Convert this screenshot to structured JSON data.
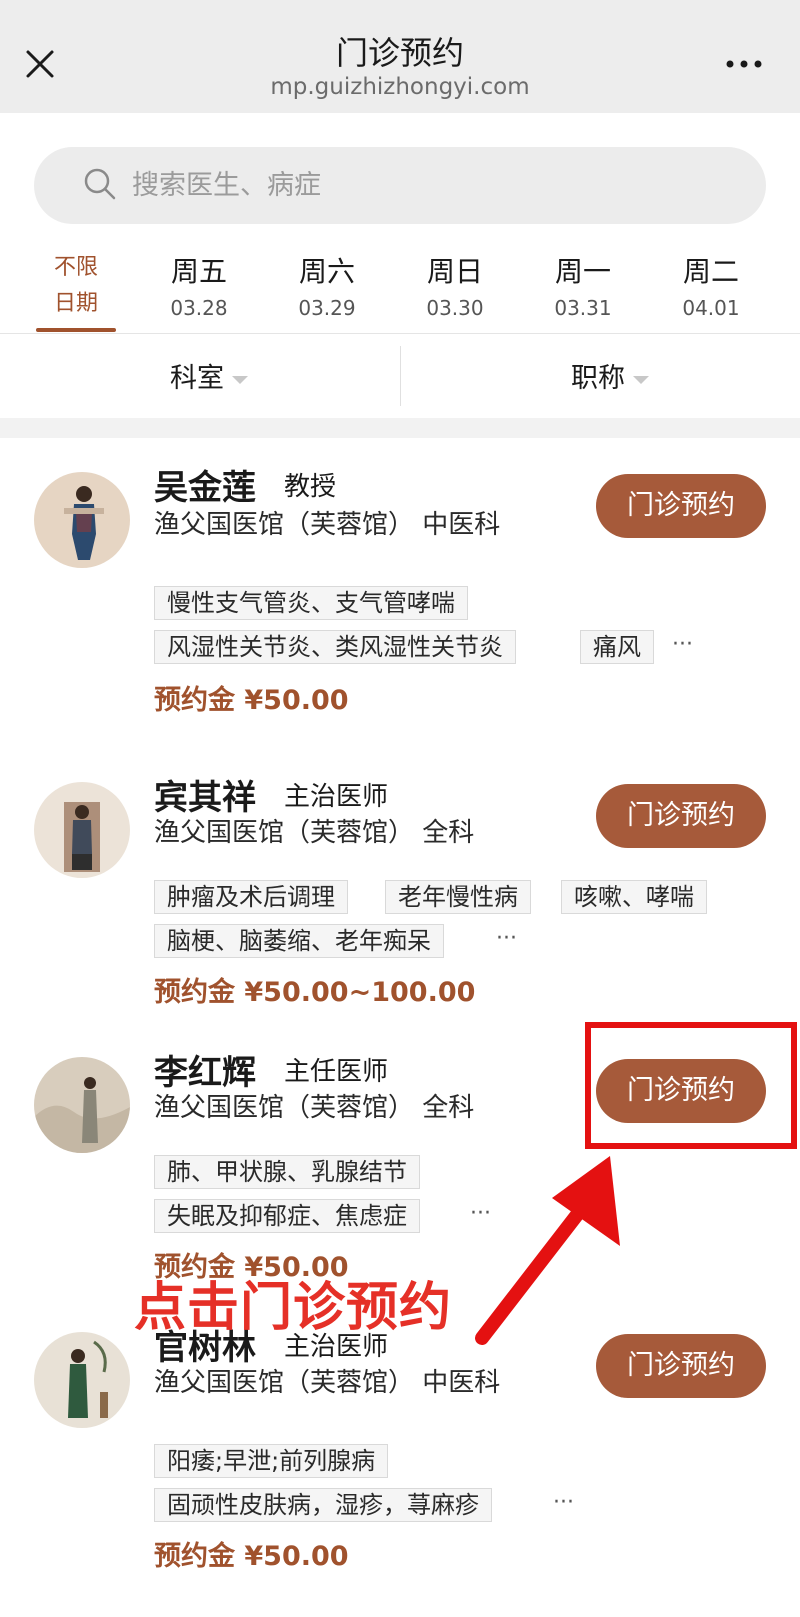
{
  "header": {
    "title": "门诊预约",
    "url": "mp.guizhizhongyi.com"
  },
  "search": {
    "placeholder": "搜索医生、病症"
  },
  "date_tabs": {
    "unlimited_line1": "不限",
    "unlimited_line2": "日期",
    "days": [
      {
        "weekday": "周五",
        "date": "03.28"
      },
      {
        "weekday": "周六",
        "date": "03.29"
      },
      {
        "weekday": "周日",
        "date": "03.30"
      },
      {
        "weekday": "周一",
        "date": "03.31"
      },
      {
        "weekday": "周二",
        "date": "04.01"
      }
    ]
  },
  "filters": {
    "department": "科室",
    "title": "职称"
  },
  "doctors": [
    {
      "name": "吴金莲",
      "title": "教授",
      "hospital": "渔父国医馆（芙蓉馆） 中医科",
      "tags": [
        "慢性支气管炎、支气管哮喘",
        "风湿性关节炎、类风湿性关节炎",
        "痛风"
      ],
      "ellipsis": "···",
      "deposit": "预约金 ¥50.00",
      "button": "门诊预约"
    },
    {
      "name": "宾其祥",
      "title": "主治医师",
      "hospital": "渔父国医馆（芙蓉馆） 全科",
      "tags": [
        "肿瘤及术后调理",
        "老年慢性病",
        "咳嗽、哮喘",
        "脑梗、脑萎缩、老年痴呆"
      ],
      "ellipsis": "···",
      "deposit": "预约金 ¥50.00~100.00",
      "button": "门诊预约"
    },
    {
      "name": "李红辉",
      "title": "主任医师",
      "hospital": "渔父国医馆（芙蓉馆） 全科",
      "tags": [
        "肺、甲状腺、乳腺结节",
        "失眠及抑郁症、焦虑症"
      ],
      "ellipsis": "···",
      "deposit": "预约金 ¥50.00",
      "button": "门诊预约"
    },
    {
      "name": "官树林",
      "title": "主治医师",
      "hospital": "渔父国医馆（芙蓉馆） 中医科",
      "tags": [
        "阳痿;早泄;前列腺病",
        "固顽性皮肤病，湿疹，荨麻疹"
      ],
      "ellipsis": "···",
      "deposit": "预约金 ¥50.00",
      "button": "门诊预约"
    }
  ],
  "annotation": {
    "text": "点击门诊预约",
    "color": "#e41111"
  },
  "colors": {
    "accent": "#a65a3a",
    "header_bg": "#ededed"
  }
}
